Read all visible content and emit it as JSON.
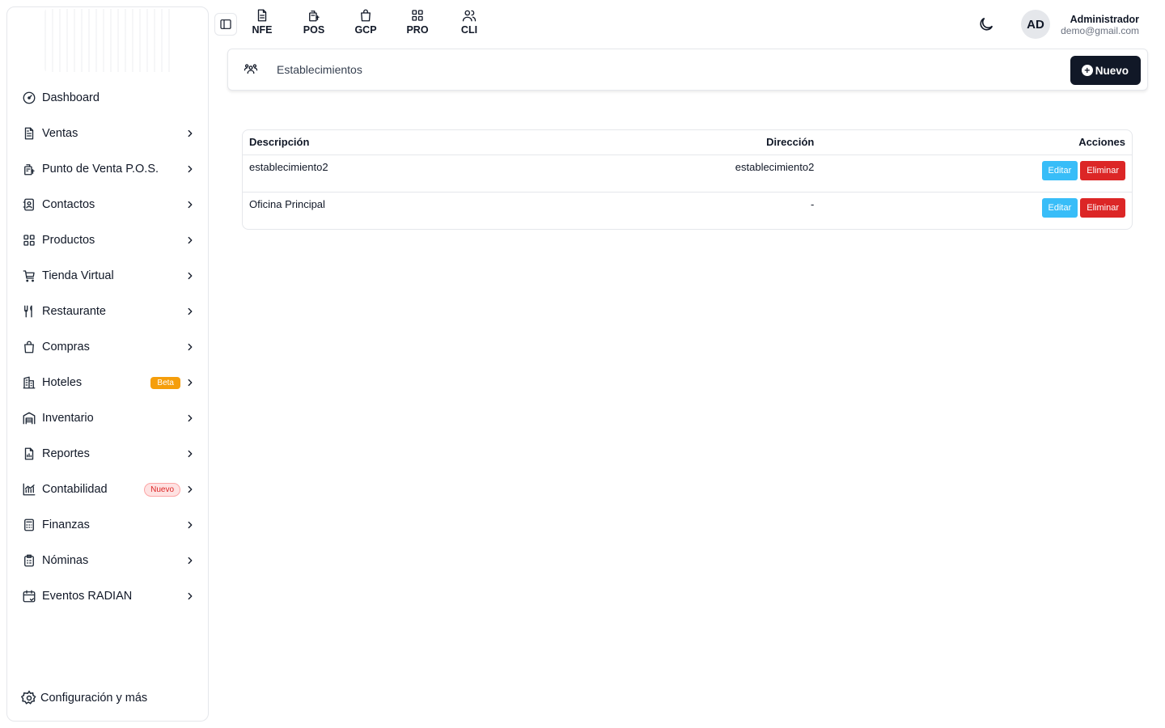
{
  "sidebar": {
    "items": [
      {
        "label": "Dashboard",
        "icon": "dashboard-icon",
        "chevron": false
      },
      {
        "label": "Ventas",
        "icon": "document-icon",
        "chevron": true
      },
      {
        "label": "Punto de Venta P.O.S.",
        "icon": "pos-icon",
        "chevron": true
      },
      {
        "label": "Contactos",
        "icon": "contacts-icon",
        "chevron": true
      },
      {
        "label": "Productos",
        "icon": "grid-icon",
        "chevron": true
      },
      {
        "label": "Tienda Virtual",
        "icon": "cart-icon",
        "chevron": true
      },
      {
        "label": "Restaurante",
        "icon": "utensils-icon",
        "chevron": true
      },
      {
        "label": "Compras",
        "icon": "bag-icon",
        "chevron": true
      },
      {
        "label": "Hoteles",
        "icon": "building-icon",
        "chevron": true,
        "badge": "Beta"
      },
      {
        "label": "Inventario",
        "icon": "warehouse-icon",
        "chevron": true
      },
      {
        "label": "Reportes",
        "icon": "report-icon",
        "chevron": true
      },
      {
        "label": "Contabilidad",
        "icon": "chart-icon",
        "chevron": true,
        "badge": "Nuevo"
      },
      {
        "label": "Finanzas",
        "icon": "calculator-icon",
        "chevron": true
      },
      {
        "label": "Nóminas",
        "icon": "clipboard-icon",
        "chevron": true
      },
      {
        "label": "Eventos RADIAN",
        "icon": "calendar-icon",
        "chevron": true
      }
    ],
    "config_label": "Configuración y más"
  },
  "topbar": {
    "modules": [
      "NFE",
      "POS",
      "GCP",
      "PRO",
      "CLI"
    ],
    "avatar_initials": "AD",
    "user_name": "Administrador",
    "user_email": "demo@gmail.com"
  },
  "header": {
    "title": "Establecimientos",
    "new_button": "Nuevo"
  },
  "table": {
    "columns": [
      "Descripción",
      "Dirección",
      "Acciones"
    ],
    "rows": [
      {
        "descripcion": "establecimiento2",
        "direccion": "establecimiento2"
      },
      {
        "descripcion": "Oficina Principal",
        "direccion": "-"
      }
    ],
    "edit_label": "Editar",
    "delete_label": "Eliminar"
  }
}
